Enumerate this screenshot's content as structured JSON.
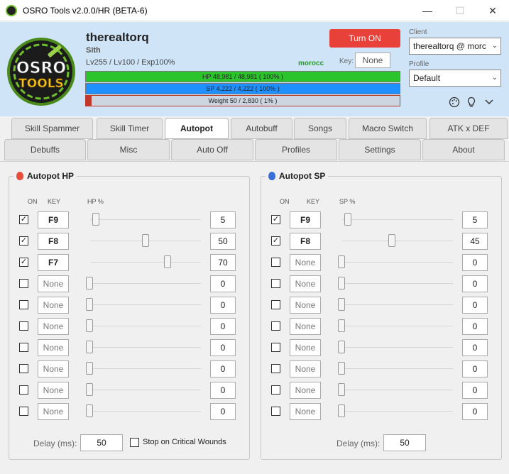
{
  "window": {
    "title": "OSRO Tools v2.0.0/HR (BETA-6)",
    "minimize": "—",
    "maximize": "☐",
    "close": "✕"
  },
  "logo": {
    "line1": "OSRO",
    "line2": "TOOLS"
  },
  "character": {
    "name": "therealtorq",
    "class": "Sith",
    "level_text": "Lv255 / Lv100 / Exp100%",
    "server": "morocc"
  },
  "key": {
    "label": "Key:",
    "value": "None"
  },
  "turn_on_label": "Turn ON",
  "bars": {
    "hp": {
      "text": "HP  48,981  /  48,981  ( 100% )",
      "percent": 100,
      "color": "#2cc42c"
    },
    "sp": {
      "text": "SP  4,222  /  4,222  ( 100% )",
      "percent": 100,
      "color": "#1e90ff"
    },
    "weight": {
      "text": "Weight  50  /  2,830  ( 1% )",
      "percent": 1.8,
      "color": "#c0392b"
    }
  },
  "client": {
    "label": "Client",
    "value": "therealtorq @ morc"
  },
  "profile": {
    "label": "Profile",
    "value": "Default"
  },
  "header_icons": [
    "palette-icon",
    "lightbulb-icon",
    "chevron-down-icon"
  ],
  "tabs_row1": [
    "Skill Spammer",
    "Skill Timer",
    "Autopot",
    "Autobuff",
    "Songs",
    "Macro Switch",
    "ATK x DEF"
  ],
  "tabs_row2": [
    "Debuffs",
    "Misc",
    "Auto Off",
    "Profiles",
    "Settings",
    "About"
  ],
  "active_tab": "Autopot",
  "hp_group": {
    "title": "Autopot HP",
    "headers": {
      "on": "ON",
      "key": "KEY",
      "pct": "HP %"
    },
    "rows": [
      {
        "on": true,
        "key": "F9",
        "value": "5"
      },
      {
        "on": true,
        "key": "F8",
        "value": "50"
      },
      {
        "on": true,
        "key": "F7",
        "value": "70"
      },
      {
        "on": false,
        "key": "None",
        "value": "0"
      },
      {
        "on": false,
        "key": "None",
        "value": "0"
      },
      {
        "on": false,
        "key": "None",
        "value": "0"
      },
      {
        "on": false,
        "key": "None",
        "value": "0"
      },
      {
        "on": false,
        "key": "None",
        "value": "0"
      },
      {
        "on": false,
        "key": "None",
        "value": "0"
      },
      {
        "on": false,
        "key": "None",
        "value": "0"
      }
    ],
    "delay_label": "Delay (ms):",
    "delay": "50",
    "critical_label": "Stop on Critical Wounds",
    "critical": false
  },
  "sp_group": {
    "title": "Autopot SP",
    "headers": {
      "on": "ON",
      "key": "KEY",
      "pct": "SP %"
    },
    "rows": [
      {
        "on": true,
        "key": "F9",
        "value": "5"
      },
      {
        "on": true,
        "key": "F8",
        "value": "45"
      },
      {
        "on": false,
        "key": "None",
        "value": "0"
      },
      {
        "on": false,
        "key": "None",
        "value": "0"
      },
      {
        "on": false,
        "key": "None",
        "value": "0"
      },
      {
        "on": false,
        "key": "None",
        "value": "0"
      },
      {
        "on": false,
        "key": "None",
        "value": "0"
      },
      {
        "on": false,
        "key": "None",
        "value": "0"
      },
      {
        "on": false,
        "key": "None",
        "value": "0"
      },
      {
        "on": false,
        "key": "None",
        "value": "0"
      }
    ],
    "delay_label": "Delay (ms):",
    "delay": "50"
  },
  "colors": {
    "accent": "#e8413a",
    "header_bg": "#cfe4f7",
    "hp_potion": "#e74c3c",
    "sp_potion": "#3b6fd8"
  }
}
